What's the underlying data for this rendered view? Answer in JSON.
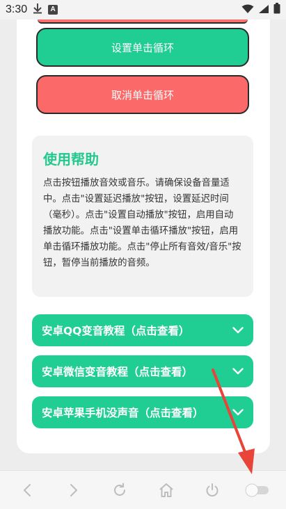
{
  "status": {
    "time": "3:30",
    "icons": [
      "download-icon",
      "a-app-icon",
      "wifi-icon",
      "signal-icon",
      "battery-icon"
    ],
    "a_icon_letter": "A"
  },
  "buttons": {
    "loop": "设置单击循环",
    "cancel": "取消单击循环"
  },
  "help": {
    "title": "使用帮助",
    "body": "点击按钮播放音效或音乐。请确保设备音量适中。点击\"设置延迟播放\"按钮，设置延迟时间（毫秒）。点击\"设置自动播放\"按钮，启用自动播放功能。点击\"设置单击循环播放\"按钮，启用单击循环播放功能。点击\"停止所有音效/音乐\"按钮，暂停当前播放的音频。"
  },
  "accordions": [
    {
      "label": "安卓QQ变音教程（点击查看）"
    },
    {
      "label": "安卓微信变音教程（点击查看）"
    },
    {
      "label": "安卓苹果手机没声音（点击查看）"
    }
  ],
  "nav": {
    "icons": [
      "back-icon",
      "forward-icon",
      "refresh-icon",
      "home-icon",
      "power-icon",
      "toggle-icon"
    ]
  },
  "colors": {
    "accent_green": "#20cd93",
    "accent_red": "#fb6a69",
    "arrow_red": "#e8443a"
  }
}
